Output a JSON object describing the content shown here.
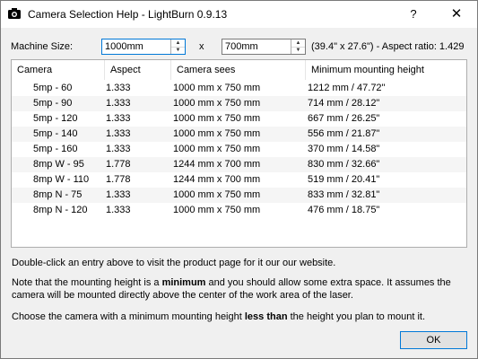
{
  "window": {
    "title": "Camera Selection Help - LightBurn 0.9.13",
    "help": "?",
    "close": "✕"
  },
  "machine": {
    "label": "Machine Size:",
    "width_value": "1000mm",
    "times": "x",
    "height_value": "700mm",
    "info": "(39.4\" x 27.6\") - Aspect ratio: 1.429"
  },
  "table": {
    "columns": [
      "Camera",
      "Aspect",
      "Camera sees",
      "Minimum mounting height"
    ],
    "rows": [
      [
        "5mp - 60",
        "1.333",
        "1000 mm x 750 mm",
        "1212 mm / 47.72\""
      ],
      [
        "5mp - 90",
        "1.333",
        "1000 mm x 750 mm",
        "714 mm / 28.12\""
      ],
      [
        "5mp - 120",
        "1.333",
        "1000 mm x 750 mm",
        "667 mm / 26.25\""
      ],
      [
        "5mp - 140",
        "1.333",
        "1000 mm x 750 mm",
        "556 mm / 21.87\""
      ],
      [
        "5mp - 160",
        "1.333",
        "1000 mm x 750 mm",
        "370 mm / 14.58\""
      ],
      [
        "8mp W - 95",
        "1.778",
        "1244 mm x 700 mm",
        "830 mm / 32.66\""
      ],
      [
        "8mp W - 110",
        "1.778",
        "1244 mm x 700 mm",
        "519 mm / 20.41\""
      ],
      [
        "8mp N - 75",
        "1.333",
        "1000 mm x 750 mm",
        "833 mm / 32.81\""
      ],
      [
        "8mp N - 120",
        "1.333",
        "1000 mm x 750 mm",
        "476 mm / 18.75\""
      ]
    ]
  },
  "help_text": {
    "line1": "Double-click an entry above to visit the product page for it our our website.",
    "note_a": "Note that the mounting height is a ",
    "note_bold": "minimum",
    "note_b": " and you should allow some extra space. It assumes the camera will be mounted directly above the center of the work area of the laser.",
    "choose_a": "Choose the camera with a minimum mounting height ",
    "choose_bold": "less than",
    "choose_b": " the height you plan to mount it."
  },
  "buttons": {
    "ok": "OK"
  }
}
